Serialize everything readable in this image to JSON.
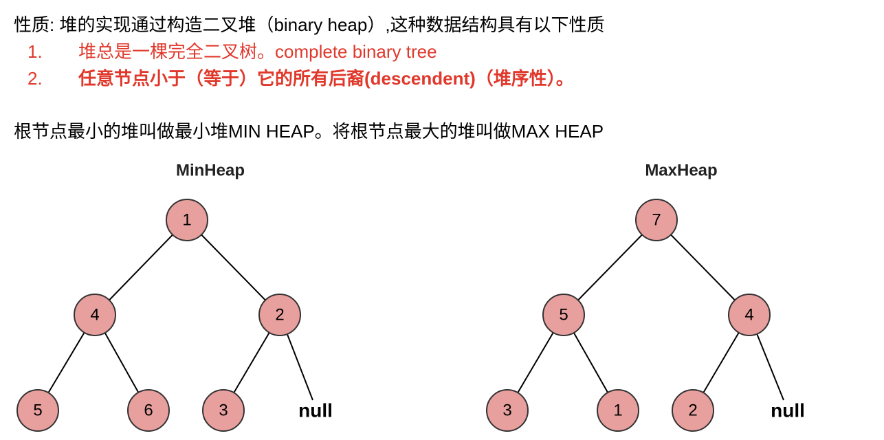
{
  "intro": "性质: 堆的实现通过构造二叉堆（binary heap）,这种数据结构具有以下性质",
  "properties": [
    {
      "number": "1.",
      "text": "堆总是一棵完全二叉树。complete binary tree"
    },
    {
      "number": "2.",
      "text": "任意节点小于（等于）它的所有后裔(descendent)（堆序性）。"
    }
  ],
  "summary": "根节点最小的堆叫做最小堆MIN HEAP。将根节点最大的堆叫做MAX HEAP",
  "colors": {
    "highlight_text": "#e0382b",
    "node_fill": "#e8a09e",
    "node_stroke": "#333333"
  },
  "trees": [
    {
      "title": "MinHeap",
      "root": "1",
      "level2": [
        "4",
        "2"
      ],
      "level3": [
        "5",
        "6",
        "3"
      ],
      "null_label": "null"
    },
    {
      "title": "MaxHeap",
      "root": "7",
      "level2": [
        "5",
        "4"
      ],
      "level3": [
        "3",
        "1",
        "2"
      ],
      "null_label": "null"
    }
  ]
}
